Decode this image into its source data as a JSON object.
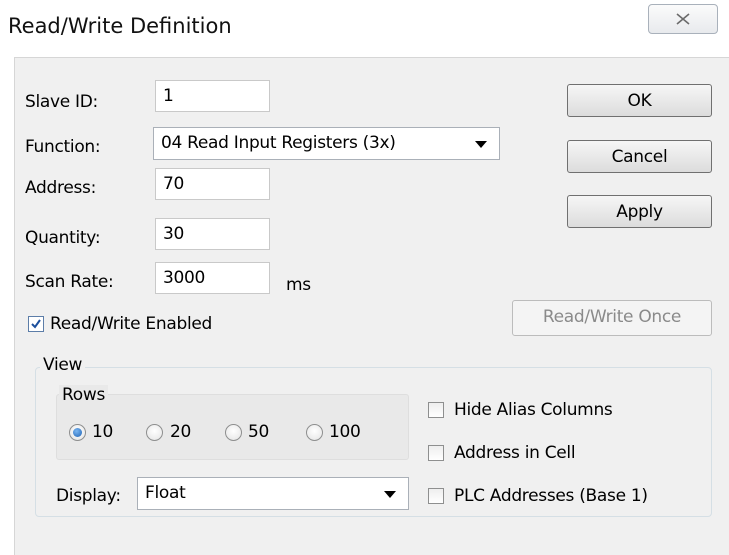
{
  "dialog": {
    "title": "Read/Write Definition",
    "close_icon": "close-x-icon"
  },
  "form": {
    "slave_id": {
      "label": "Slave ID:",
      "value": "1"
    },
    "function": {
      "label": "Function:",
      "value": "04 Read Input Registers (3x)"
    },
    "address": {
      "label": "Address:",
      "value": "70"
    },
    "quantity": {
      "label": "Quantity:",
      "value": "30"
    },
    "scan_rate": {
      "label": "Scan Rate:",
      "value": "3000",
      "unit": "ms"
    },
    "rw_enabled": {
      "label": "Read/Write Enabled",
      "checked": true
    }
  },
  "buttons": {
    "ok": "OK",
    "cancel": "Cancel",
    "apply": "Apply",
    "rw_once": "Read/Write Once"
  },
  "view": {
    "label": "View",
    "rows": {
      "label": "Rows",
      "options": [
        "10",
        "20",
        "50",
        "100"
      ],
      "selected": "10"
    },
    "display": {
      "label": "Display:",
      "value": "Float"
    },
    "options": {
      "hide_alias": {
        "label": "Hide Alias Columns",
        "checked": false
      },
      "address_in_cell": {
        "label": "Address in Cell",
        "checked": false
      },
      "plc_addresses": {
        "label": "PLC Addresses (Base 1)",
        "checked": false
      }
    }
  },
  "colors": {
    "client_bg": "#f0f0f0",
    "radio_accent": "#1f63b4",
    "check_mark": "#1c4f9c"
  }
}
